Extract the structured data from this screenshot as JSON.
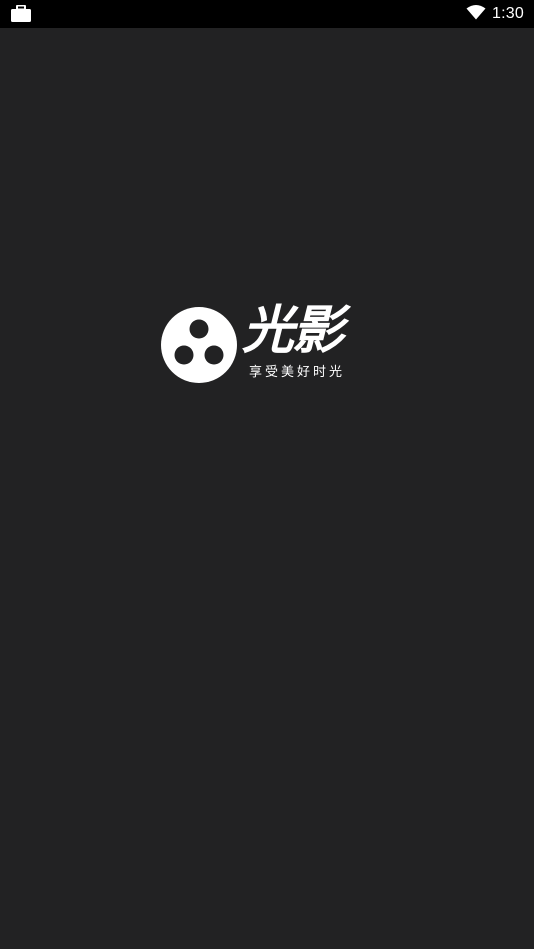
{
  "status_bar": {
    "time": "1:30",
    "left_icon": "briefcase-icon",
    "right_icons": [
      "wifi-icon"
    ]
  },
  "splash": {
    "brand_name": "光影",
    "slogan": "享受美好时光"
  },
  "colors": {
    "background": "#222223",
    "status_bar": "#000000",
    "foreground": "#ffffff"
  }
}
